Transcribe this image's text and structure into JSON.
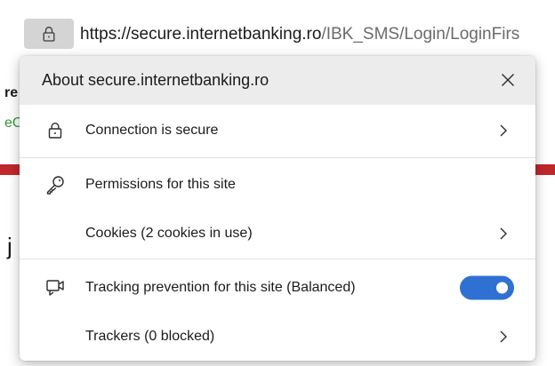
{
  "address_bar": {
    "url_host": "https://secure.internetbanking.ro",
    "url_path": "/IBK_SMS/Login/LoginFirs"
  },
  "background_page": {
    "fragment_1": "re",
    "fragment_2": "eC",
    "fragment_3": "j",
    "accent_green": "#2e9a2e",
    "accent_red": "#c0272d"
  },
  "popup": {
    "title": "About secure.internetbanking.ro",
    "connection_label": "Connection is secure",
    "permissions_label": "Permissions for this site",
    "cookies_label": "Cookies (2 cookies in use)",
    "tracking_label": "Tracking prevention for this site (Balanced)",
    "tracking_enabled": true,
    "trackers_label": "Trackers (0 blocked)"
  },
  "icons": {
    "address_lock": "lock-icon",
    "close": "close-icon",
    "connection": "lock-icon",
    "permissions": "key-icon",
    "tracking": "tracking-prevention-icon",
    "chevron": "chevron-right-icon"
  },
  "colors": {
    "toggle_on": "#2f70d3",
    "popup_header": "#ececec"
  }
}
